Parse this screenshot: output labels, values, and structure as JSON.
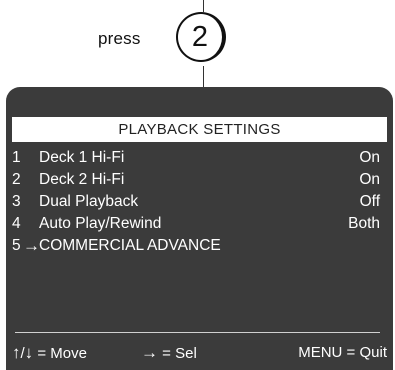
{
  "callout": {
    "press_label": "press",
    "button_label": "2"
  },
  "screen": {
    "title": "PLAYBACK SETTINGS",
    "items": [
      {
        "number": "1",
        "label": "Deck 1 Hi-Fi",
        "value": "On"
      },
      {
        "number": "2",
        "label": "Deck 2 Hi-Fi",
        "value": "On"
      },
      {
        "number": "3",
        "label": "Dual Playback",
        "value": "Off"
      },
      {
        "number": "4",
        "label": "Auto Play/Rewind",
        "value": "Both"
      },
      {
        "number": "5",
        "label": "COMMERCIAL ADVANCE",
        "value": "",
        "selected": true
      }
    ],
    "selected_indicator_icon": "right-arrow",
    "footer": {
      "up_icon": "↑",
      "separator": "/",
      "down_icon": "↓",
      "move_text": "= Move",
      "select_icon": "→",
      "select_text": "= Sel",
      "menu_text": "MENU = Quit"
    }
  },
  "colors": {
    "screen_background": "#3b3b3b",
    "screen_text": "#ffffff",
    "title_bar_background": "#ffffff",
    "title_bar_text": "#222222"
  }
}
